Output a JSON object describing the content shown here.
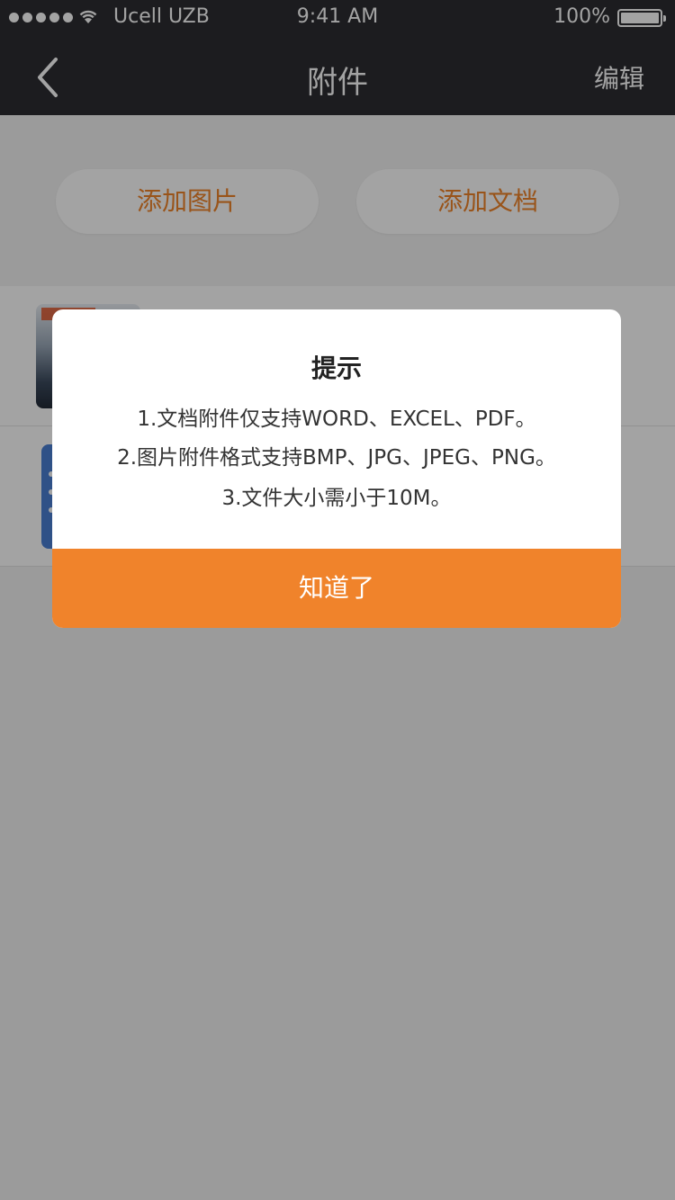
{
  "status_bar": {
    "carrier": "Ucell UZB",
    "time": "9:41 AM",
    "battery": "100%"
  },
  "nav": {
    "title": "附件",
    "edit_label": "编辑"
  },
  "actions": {
    "add_image_label": "添加图片",
    "add_document_label": "添加文档"
  },
  "dialog": {
    "title": "提示",
    "lines": [
      "1.文档附件仅支持WORD、EXCEL、PDF。",
      "2.图片附件格式支持BMP、JPG、JPEG、PNG。",
      "3.文件大小需小于10M。"
    ],
    "confirm_label": "知道了"
  },
  "colors": {
    "accent": "#f0832b",
    "nav_bg": "#2c2d31",
    "doc_icon": "#4a7fd3"
  },
  "icons": {
    "back": "chevron-left-icon",
    "wifi": "wifi-icon",
    "battery": "battery-icon",
    "document": "document-icon"
  }
}
